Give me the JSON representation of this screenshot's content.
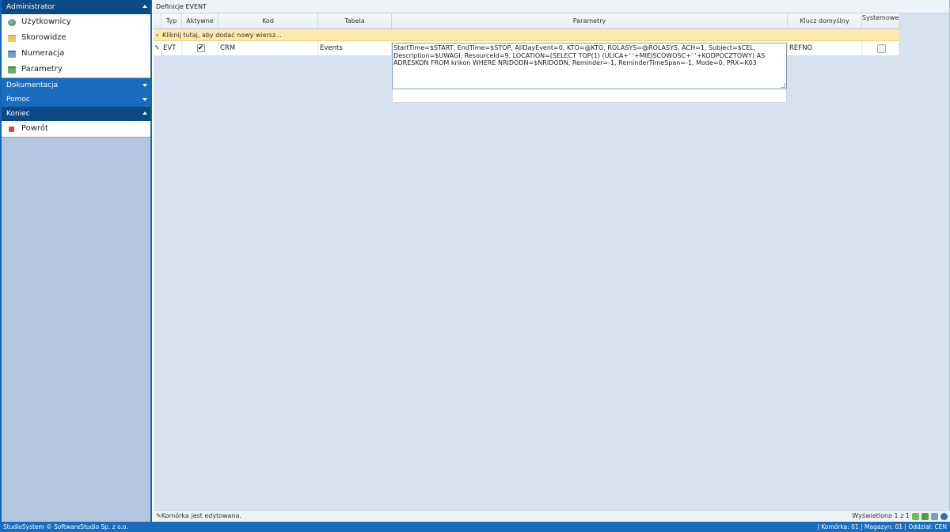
{
  "sidebar": {
    "sections": [
      {
        "title": "Administrator",
        "items": [
          "Użytkownicy",
          "Skorowidze",
          "Numeracja",
          "Parametry"
        ]
      },
      {
        "title": "Dokumentacja"
      },
      {
        "title": "Pomoc"
      },
      {
        "title": "Koniec",
        "items": [
          "Powrót"
        ]
      }
    ]
  },
  "main": {
    "title": "Definicje EVENT",
    "columns": [
      "Typ",
      "Aktywne",
      "Kod",
      "Tabela",
      "Parametry",
      "Klucz domyślny",
      "Systemowe"
    ],
    "new_row_hint": "Kliknij tutaj, aby dodać nowy wiersz...",
    "rows": [
      {
        "typ": "EVT",
        "aktywne": true,
        "aktywne_mark": "✔",
        "kod": "CRM",
        "tabela": "Events",
        "parametry": "StartTime=$START, EndTime=$STOP, AllDayEvent=0, KTO=@KTO, ROLASYS=@ROLASYS, ACH=1, Subject=$CEL, Description=$UWAGI, ResourceId=9, LOCATION=(SELECT TOP(1) (ULICA+' '+MIEJSCOWOSC+' '+KODPOCZTOWY) AS ADRESKON FROM krikon WHERE NRIDODN=$NRIDODN, Reminder=-1, ReminderTimeSpan=-1, Mode=0, PRX=K03",
        "klucz": "REFNO",
        "systemowe": false
      }
    ]
  },
  "status": {
    "left": "Komórka jest edytowana.",
    "right": "Wyświetlono 1 z 1"
  },
  "footer": {
    "left": "StudioSystem © SoftwareStudio Sp. z o.o.",
    "right": "| Komórka: 01 | Magazyn: 01 | Oddział: CEN"
  },
  "colors": {
    "accent": "#1a6cbf",
    "header_dark": "#0c4a83",
    "new_row": "#fde9a9"
  }
}
